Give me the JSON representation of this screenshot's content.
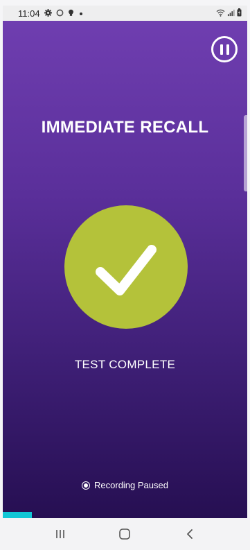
{
  "status_bar": {
    "time": "11:04",
    "left_icons": [
      "settings-icon",
      "circle-icon",
      "lightbulb-icon",
      "dot-icon"
    ],
    "right_icons": [
      "wifi-icon",
      "signal-icon",
      "battery-icon"
    ]
  },
  "screen": {
    "title": "IMMEDIATE RECALL",
    "result_text": "TEST COMPLETE",
    "recording_status": "Recording Paused",
    "progress_fraction": 0.12,
    "colors": {
      "background_top": "#6f3eb0",
      "background_bottom": "#260f52",
      "check_circle": "#b4c23a",
      "progress": "#12c7d6"
    },
    "icons": {
      "pause": "pause-icon",
      "check": "checkmark-icon",
      "recording": "record-icon"
    }
  },
  "nav_bar": {
    "icons": [
      "recents-icon",
      "home-icon",
      "back-icon"
    ]
  }
}
